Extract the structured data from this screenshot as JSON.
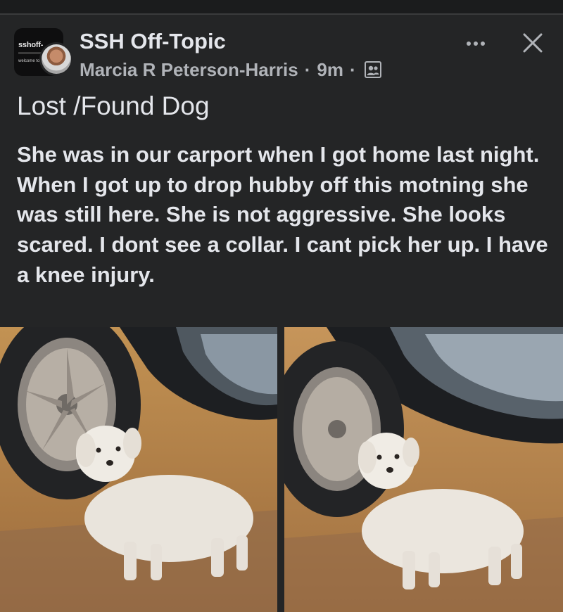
{
  "post": {
    "group_name": "SSH Off-Topic",
    "author": "Marcia R Peterson-Harris",
    "separator": "·",
    "time": "9m",
    "audience_icon": "members-icon",
    "title": "Lost /Found Dog",
    "body": "She was in our carport when I got home last night.  When I got up to drop hubby off this motning she was still here.  She is not aggressive.  She looks scared.  I dont see a collar.  I cant pick her up.  I have a knee injury."
  },
  "group_avatar": {
    "brand": "sshoff-",
    "tagline": "welcome to t"
  },
  "header_actions": {
    "more_icon": "more-horizontal-icon",
    "close_icon": "close-icon"
  },
  "photos": [
    {
      "name": "photo-dog-1",
      "subject": "small white dog standing beside a car wheel"
    },
    {
      "name": "photo-dog-2",
      "subject": "small white dog standing beside a car wheel"
    }
  ],
  "colors": {
    "background": "#242526",
    "primary_text": "#e4e6eb",
    "secondary_text": "#b0b3b8",
    "brand_accent": "#e0a331"
  }
}
